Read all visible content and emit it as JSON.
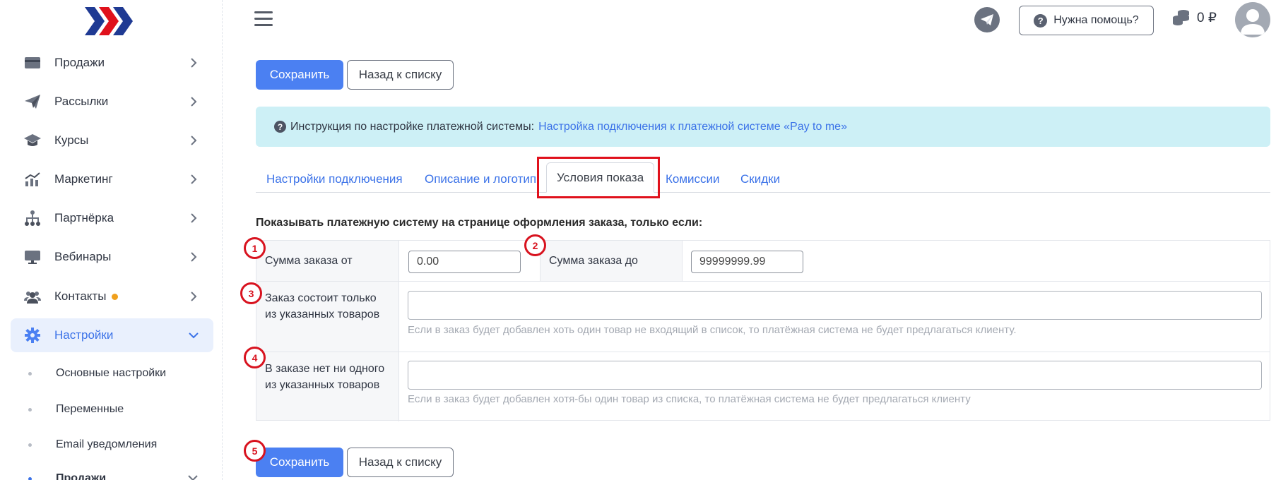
{
  "sidebar": {
    "items": [
      {
        "label": "Продажи",
        "icon": "card-icon"
      },
      {
        "label": "Рассылки",
        "icon": "paper-plane-icon"
      },
      {
        "label": "Курсы",
        "icon": "graduation-cap-icon"
      },
      {
        "label": "Маркетинг",
        "icon": "chart-icon"
      },
      {
        "label": "Партнёрка",
        "icon": "hierarchy-icon"
      },
      {
        "label": "Вебинары",
        "icon": "monitor-icon"
      },
      {
        "label": "Контакты",
        "icon": "users-icon",
        "badge_color": "#f0a01c"
      },
      {
        "label": "Настройки",
        "icon": "gear-icon",
        "active": true
      }
    ],
    "subitems": [
      "Основные настройки",
      "Переменные",
      "Email уведомления",
      "Продажи"
    ]
  },
  "header": {
    "help_label": "Нужна помощь?",
    "balance": "0 ₽"
  },
  "toolbar": {
    "save_label": "Сохранить",
    "back_label": "Назад к списку"
  },
  "info": {
    "text": "Инструкция по настройке платежной системы:",
    "link": "Настройка подключения к платежной системе «Pay to me»"
  },
  "tabs": [
    "Настройки подключения",
    "Описание и логотип",
    "Условия показа",
    "Комиссии",
    "Скидки"
  ],
  "active_tab": "Условия показа",
  "form": {
    "heading": "Показывать платежную систему на странице оформления заказа, только если:",
    "sum_from_label": "Сумма заказа от",
    "sum_from_value": "0.00",
    "sum_to_label": "Сумма заказа до",
    "sum_to_value": "99999999.99",
    "only_items_label": "Заказ состоит только из указанных товаров",
    "only_items_hint": "Если в заказ будет добавлен хоть один товар не входящий в список, то платёжная система не будет предлагаться клиенту.",
    "no_items_label": "В заказе нет ни одного из указанных товаров",
    "no_items_hint": "Если в заказ будет добавлен хотя-бы один товар из списка, то платёжная система не будет предлагаться клиенту"
  },
  "annotations": [
    "1",
    "2",
    "3",
    "4",
    "5"
  ],
  "colors": {
    "accent": "#4b80f2",
    "link": "#3b72e8",
    "info_bg": "#cdf0f6",
    "highlight": "#e0111c",
    "logo_dark": "#1f3a93",
    "logo_red": "#e0111c"
  }
}
